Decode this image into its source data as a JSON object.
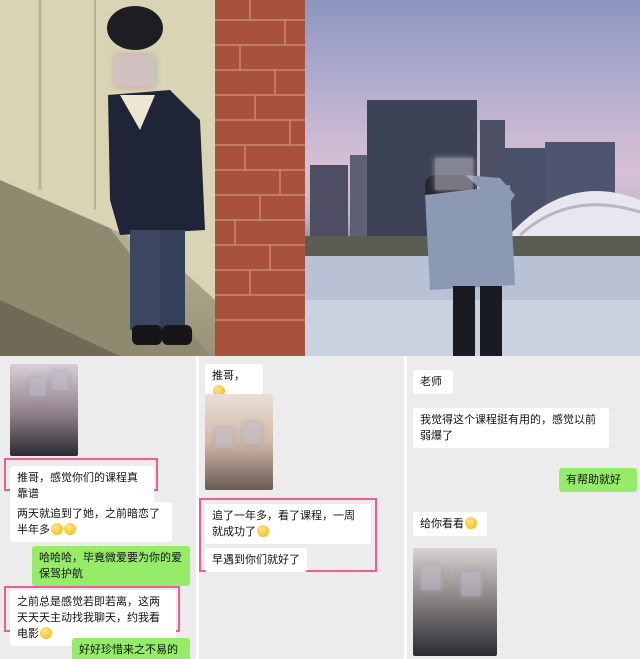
{
  "panel1": {
    "msg1": "推哥，感觉你们的课程真靠谱",
    "msg2": "两天就追到了她，之前暗恋了半年多",
    "msg3": "哈哈哈，毕竟微爱要为你的爱保驾护航",
    "msg4": "之前总是感觉若即若离，这两天天天主动找我聊天，约我看电影",
    "msg5": "好好珍惜来之不易的幸福"
  },
  "panel2": {
    "msg1": "推哥，",
    "msg2": "追了一年多，看了课程，一周就成功了",
    "msg3": "早遇到你们就好了"
  },
  "panel3": {
    "msg1": "老师",
    "msg2": "我觉得这个课程挺有用的，感觉以前弱爆了",
    "msg3": "有帮助就好",
    "msg4": "给你看看"
  },
  "colors": {
    "highlight": "#ef5d93",
    "sent_bubble": "#95ec69",
    "received_bubble": "#ffffff"
  },
  "icons": [
    "smile-emoji-icon",
    "wink-emoji-icon"
  ]
}
